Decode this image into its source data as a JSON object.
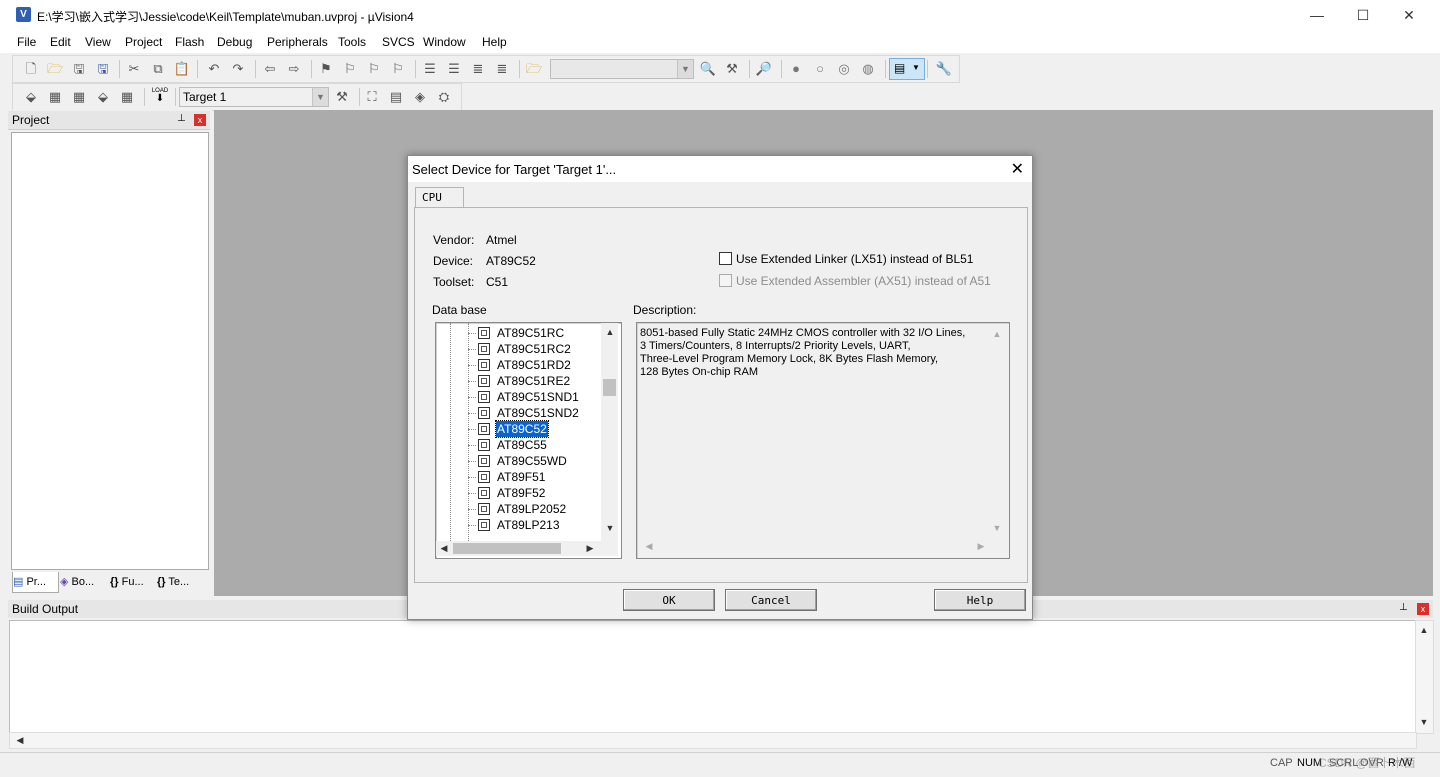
{
  "window": {
    "title": "E:\\学习\\嵌入式学习\\Jessie\\code\\Keil\\Template\\muban.uvproj - µVision4",
    "app_icon_letter": "V",
    "minimize": "—",
    "maximize": "☐",
    "close": "✕"
  },
  "menu": [
    "File",
    "Edit",
    "View",
    "Project",
    "Flash",
    "Debug",
    "Peripherals",
    "Tools",
    "SVCS",
    "Window",
    "Help"
  ],
  "toolbar2": {
    "target_select": "Target 1",
    "load_label": "LOAD"
  },
  "project_panel": {
    "title": "Project",
    "pin": "⊥",
    "close": "x",
    "tabs": [
      "Pr...",
      "Bo...",
      "Fu...",
      "Te..."
    ]
  },
  "build_output": {
    "title": "Build Output",
    "pin": "⊥",
    "close": "x"
  },
  "status_bar": {
    "cap": "CAP",
    "num": "NUM",
    "scrl": "SCRL",
    "ovr": "OVR",
    "rw": "R /W",
    "watermark": "CSDN @酉卜木西"
  },
  "dialog": {
    "title": "Select Device for Target 'Target 1'...",
    "close": "✕",
    "tab": "CPU",
    "vendor_label": "Vendor:",
    "vendor_value": "Atmel",
    "device_label": "Device:",
    "device_value": "AT89C52",
    "toolset_label": "Toolset:",
    "toolset_value": "C51",
    "ext_linker_label": "Use Extended Linker (LX51) instead of BL51",
    "ext_assembler_label": "Use Extended Assembler (AX51) instead of A51",
    "database_label": "Data base",
    "description_label": "Description:",
    "devices": [
      "AT89C51RC",
      "AT89C51RC2",
      "AT89C51RD2",
      "AT89C51RE2",
      "AT89C51SND1",
      "AT89C51SND2",
      "AT89C52",
      "AT89C55",
      "AT89C55WD",
      "AT89F51",
      "AT89F52",
      "AT89LP2052",
      "AT89LP213"
    ],
    "selected_device": "AT89C52",
    "description": "8051-based Fully Static 24MHz CMOS controller with 32  I/O Lines,\n3 Timers/Counters, 8 Interrupts/2 Priority Levels, UART,\nThree-Level Program Memory Lock, 8K Bytes Flash Memory,\n128 Bytes On-chip RAM",
    "ok": "OK",
    "cancel": "Cancel",
    "help": "Help"
  }
}
